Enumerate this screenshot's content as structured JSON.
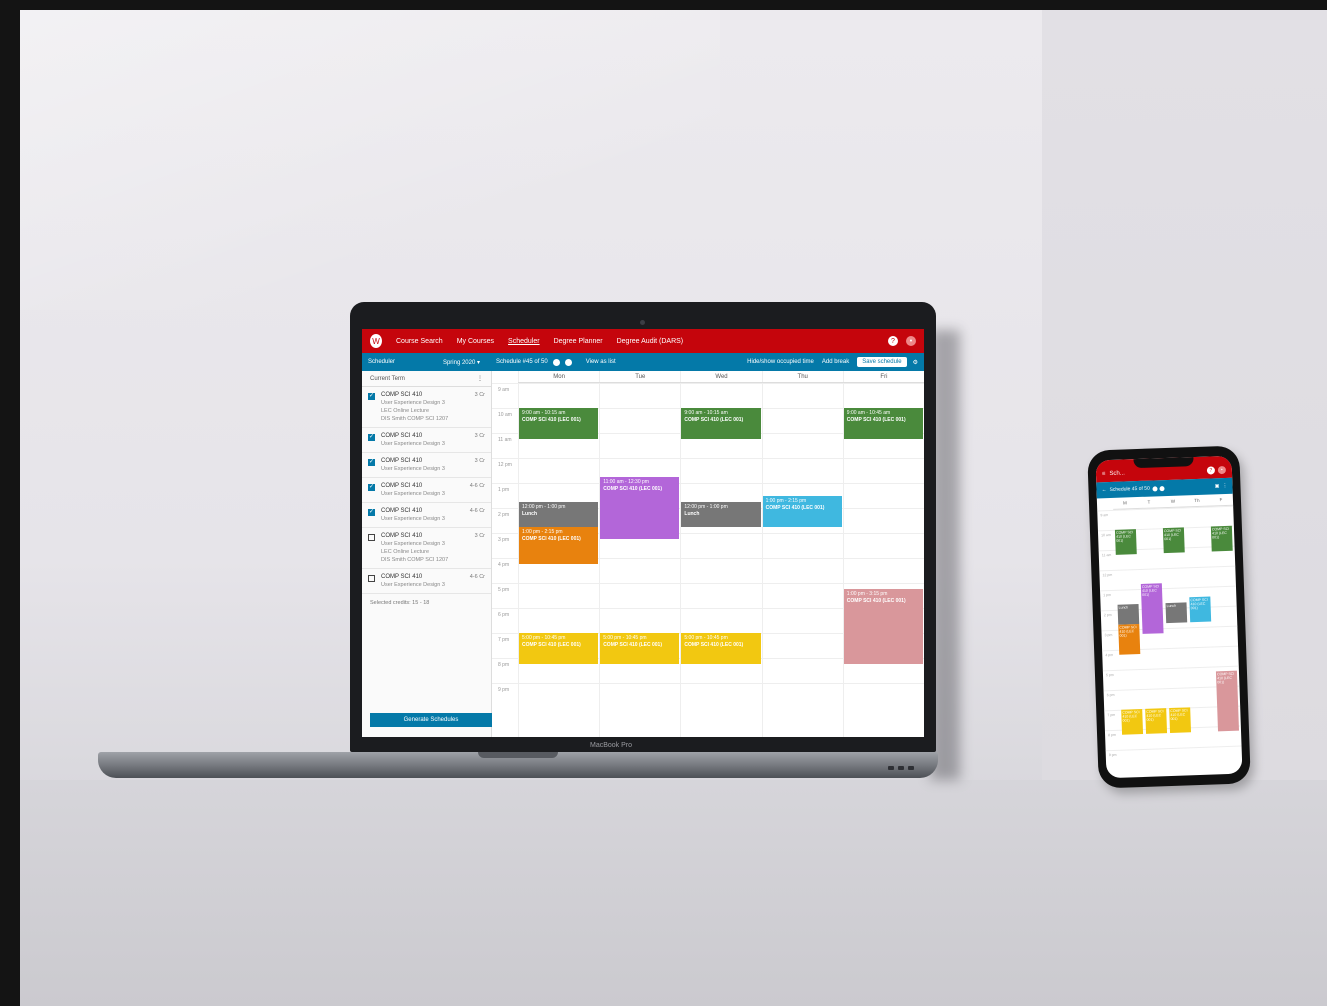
{
  "laptop": {
    "brand": "MacBook Pro"
  },
  "app": {
    "nav": {
      "items": [
        "Course Search",
        "My Courses",
        "Scheduler",
        "Degree Planner",
        "Degree Audit (DARS)"
      ],
      "help_icon": "?",
      "avatar_icon": "•"
    },
    "subbar": {
      "term_label": "Scheduler",
      "term_value": "Spring 2020 ▾",
      "schedule_label": "Schedule #45 of 50",
      "view_option": "View as list",
      "tool_1": "Hide/show occupied time",
      "tool_2": "Add break",
      "save_label": "Save schedule",
      "settings_icon": "⚙"
    },
    "sidebar": {
      "header": "Current Term",
      "menu_icon": "⋮",
      "courses": [
        {
          "checked": true,
          "code": "COMP SCI 410",
          "lines": [
            "User Experience Design 3",
            "LEC Online Lecture",
            "DIS Smith COMP SCI 1207"
          ],
          "credits": "3 Cr"
        },
        {
          "checked": true,
          "code": "COMP SCI 410",
          "lines": [
            "User Experience Design 3"
          ],
          "credits": "3 Cr"
        },
        {
          "checked": true,
          "code": "COMP SCI 410",
          "lines": [
            "User Experience Design 3"
          ],
          "credits": "3 Cr"
        },
        {
          "checked": true,
          "code": "COMP SCI 410",
          "lines": [
            "User Experience Design 3"
          ],
          "credits": "4-6 Cr"
        },
        {
          "checked": true,
          "code": "COMP SCI 410",
          "lines": [
            "User Experience Design 3"
          ],
          "credits": "4-6 Cr"
        },
        {
          "checked": false,
          "code": "COMP SCI 410",
          "lines": [
            "User Experience Design 3",
            "LEC Online Lecture",
            "DIS Smith COMP SCI 1207"
          ],
          "credits": "3 Cr"
        },
        {
          "checked": false,
          "code": "COMP SCI 410",
          "lines": [
            "User Experience Design 3"
          ],
          "credits": "4-6 Cr"
        }
      ],
      "selected_credits": "Selected credits: 15 - 18",
      "generate_label": "Generate Schedules"
    },
    "calendar": {
      "days": [
        "Mon",
        "Tue",
        "Wed",
        "Thu",
        "Fri"
      ],
      "hours": [
        "9 am",
        "10 am",
        "11 am",
        "12 pm",
        "1 pm",
        "2 pm",
        "3 pm",
        "4 pm",
        "5 pm",
        "6 pm",
        "7 pm",
        "8 pm",
        "9 pm"
      ],
      "events": [
        {
          "day": 0,
          "start": 10.0,
          "end": 11.25,
          "time": "9:00 am - 10:15 am",
          "name": "COMP SCI 410 (LEC 001)",
          "color": "#4a8a3c"
        },
        {
          "day": 2,
          "start": 10.0,
          "end": 11.25,
          "time": "9:00 am - 10:15 am",
          "name": "COMP SCI 410 (LEC 001)",
          "color": "#4a8a3c"
        },
        {
          "day": 4,
          "start": 10.0,
          "end": 11.25,
          "time": "9:00 am - 10:45 am",
          "name": "COMP SCI 410 (LEC 001)",
          "color": "#4a8a3c"
        },
        {
          "day": 1,
          "start": 12.75,
          "end": 15.25,
          "time": "11:00 am - 12:30 pm",
          "name": "COMP SCI 410 (LEC 001)",
          "color": "#b366d9"
        },
        {
          "day": 0,
          "start": 13.75,
          "end": 14.75,
          "time": "12:00 pm - 1:00 pm",
          "name": "Lunch",
          "color": "#777777"
        },
        {
          "day": 2,
          "start": 13.75,
          "end": 14.75,
          "time": "12:00 pm - 1:00 pm",
          "name": "Lunch",
          "color": "#777777"
        },
        {
          "day": 3,
          "start": 13.5,
          "end": 14.75,
          "time": "1:00 pm - 2:15 pm",
          "name": "COMP SCI 410 (LEC 001)",
          "color": "#3fb8e0"
        },
        {
          "day": 0,
          "start": 14.75,
          "end": 16.25,
          "time": "1:00 pm - 2:15 pm",
          "name": "COMP SCI 410 (LEC 001)",
          "color": "#e8820e"
        },
        {
          "day": 4,
          "start": 17.25,
          "end": 20.25,
          "time": "1:00 pm - 3:15 pm",
          "name": "COMP SCI 410 (LEC 001)",
          "color": "#d9979b"
        },
        {
          "day": 0,
          "start": 19.0,
          "end": 20.25,
          "time": "5:00 pm - 10:45 pm",
          "name": "COMP SCI 410 (LEC 001)",
          "color": "#f2c811"
        },
        {
          "day": 1,
          "start": 19.0,
          "end": 20.25,
          "time": "5:00 pm - 10:45 pm",
          "name": "COMP SCI 410 (LEC 001)",
          "color": "#f2c811"
        },
        {
          "day": 2,
          "start": 19.0,
          "end": 20.25,
          "time": "5:00 pm - 10:45 pm",
          "name": "COMP SCI 410 (LEC 001)",
          "color": "#f2c811"
        }
      ]
    }
  },
  "phone": {
    "title": "Sch...",
    "schedule_label": "Schedule 45 of 50",
    "days": [
      "M",
      "T",
      "W",
      "Th",
      "F"
    ]
  }
}
